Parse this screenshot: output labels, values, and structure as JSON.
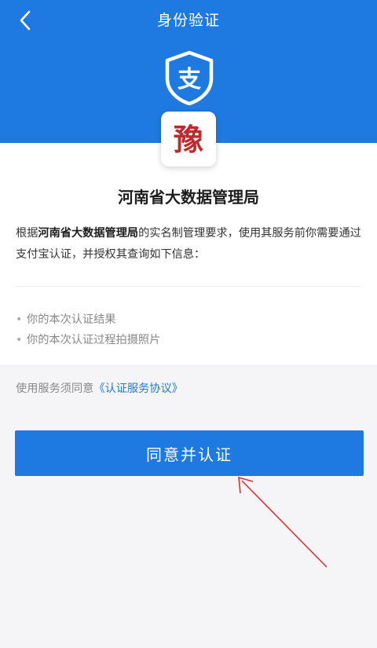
{
  "header": {
    "title": "身份验证",
    "back_icon": "chevron-left-icon",
    "badge_icon": "alipay-shield-icon",
    "badge_char": "支",
    "color": "#1e7ae0"
  },
  "org": {
    "logo_icon": "seal-logo-icon",
    "logo_char": "豫",
    "name": "河南省大数据管理局"
  },
  "description": {
    "prefix": "根据",
    "org_name": "河南省大数据管理局",
    "suffix": "的实名制管理要求，使用其服务前你需要通过支付宝认证，并授权其查询如下信息："
  },
  "info_items": [
    "你的本次认证结果",
    "你的本次认证过程拍摄照片"
  ],
  "agreement": {
    "prefix": "使用服务须同意",
    "link": "《认证服务协议》"
  },
  "agree_button": {
    "label": "同意并认证"
  },
  "colors": {
    "accent": "#1e7ae0",
    "annotation_arrow": "#d9323a",
    "seal": "#c0282c"
  }
}
